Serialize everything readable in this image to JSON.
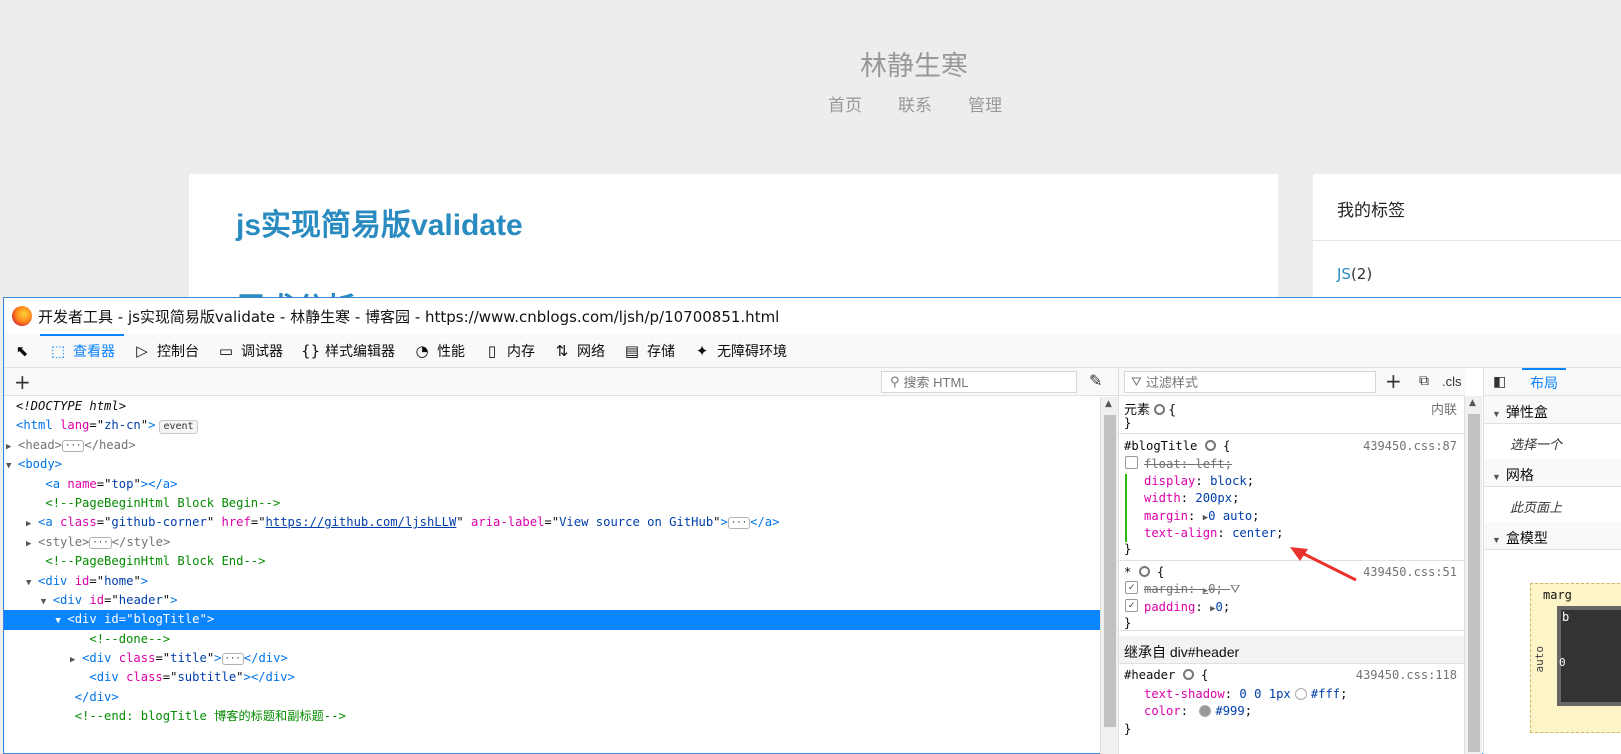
{
  "page": {
    "site_title": "林静生寒",
    "nav": [
      "首页",
      "联系",
      "管理"
    ],
    "post_title": "js实现简易版validate",
    "post_subtitle": "需求分析",
    "sidebar_heading": "我的标签",
    "sidebar_tag_name": "JS",
    "sidebar_tag_count": "(2)",
    "link_color": "#2a8bc0"
  },
  "devtools": {
    "window_title": "开发者工具 - js实现简易版validate - 林静生寒 - 博客园 - https://www.cnblogs.com/ljsh/p/10700851.html",
    "tabs": [
      {
        "label": "查看器",
        "icon": "inspector-icon",
        "glyph": "⬚"
      },
      {
        "label": "控制台",
        "icon": "console-icon",
        "glyph": "▷"
      },
      {
        "label": "调试器",
        "icon": "debugger-icon",
        "glyph": "▭"
      },
      {
        "label": "样式编辑器",
        "icon": "style-editor-icon",
        "glyph": "{}"
      },
      {
        "label": "性能",
        "icon": "performance-icon",
        "glyph": "◔"
      },
      {
        "label": "内存",
        "icon": "memory-icon",
        "glyph": "▯"
      },
      {
        "label": "网络",
        "icon": "network-icon",
        "glyph": "⇅"
      },
      {
        "label": "存储",
        "icon": "storage-icon",
        "glyph": "▤"
      },
      {
        "label": "无障碍环境",
        "icon": "accessibility-icon",
        "glyph": "✦"
      }
    ],
    "active_tab": "查看器",
    "accent": "#0a84ff",
    "search_html_placeholder": "搜索 HTML",
    "filter_styles_placeholder": "过滤样式",
    "cls_label": ".cls",
    "markup": {
      "doctype": "<!DOCTYPE html>",
      "html_lang": "zh-cn",
      "event_badge": "event",
      "comment_begin": "<!--PageBeginHtml Block Begin-->",
      "a_name": "top",
      "github_class": "github-corner",
      "github_href": "https://github.com/ljshLLW",
      "github_aria": "View source on GitHub",
      "comment_end": "<!--PageBeginHtml Block End-->",
      "home_id": "home",
      "header_id": "header",
      "blogtitle_id": "blogTitle",
      "comment_done": "<!--done-->",
      "title_class": "title",
      "subtitle_class": "subtitle",
      "comment_blogtitle_end": "<!--end: blogTitle 博客的标题和副标题-->"
    },
    "rules": {
      "element_label": "元素",
      "inline_label": "内联",
      "blogtitle_selector": "#blogTitle",
      "blogtitle_source": "439450.css:87",
      "blogtitle_props": [
        {
          "name": "float",
          "value": "left",
          "overridden": true
        },
        {
          "name": "display",
          "value": "block"
        },
        {
          "name": "width",
          "value": "200px"
        },
        {
          "name": "margin",
          "value": "0 auto",
          "expander": true
        },
        {
          "name": "text-align",
          "value": "center"
        }
      ],
      "universal_selector": "*",
      "universal_source": "439450.css:51",
      "universal_props": [
        {
          "name": "margin",
          "value": "0",
          "overridden": true,
          "checked": true
        },
        {
          "name": "padding",
          "value": "0",
          "checked": true
        }
      ],
      "inherited_label": "继承自 div#header",
      "header_selector": "#header",
      "header_source": "439450.css:118",
      "header_props": [
        {
          "name": "text-shadow",
          "value": "0 0 1px",
          "color": "#fff"
        },
        {
          "name": "color",
          "value": "#999",
          "color": "#999"
        }
      ]
    },
    "layout": {
      "tab_label": "布局",
      "flexbox_label": "弹性盒",
      "flexbox_hint": "选择一个",
      "grid_label": "网格",
      "grid_hint": "此页面上",
      "boxmodel_label": "盒模型",
      "box_margin_label": "marg",
      "box_auto": "auto",
      "box_zero": "0",
      "box_b": "b"
    }
  }
}
